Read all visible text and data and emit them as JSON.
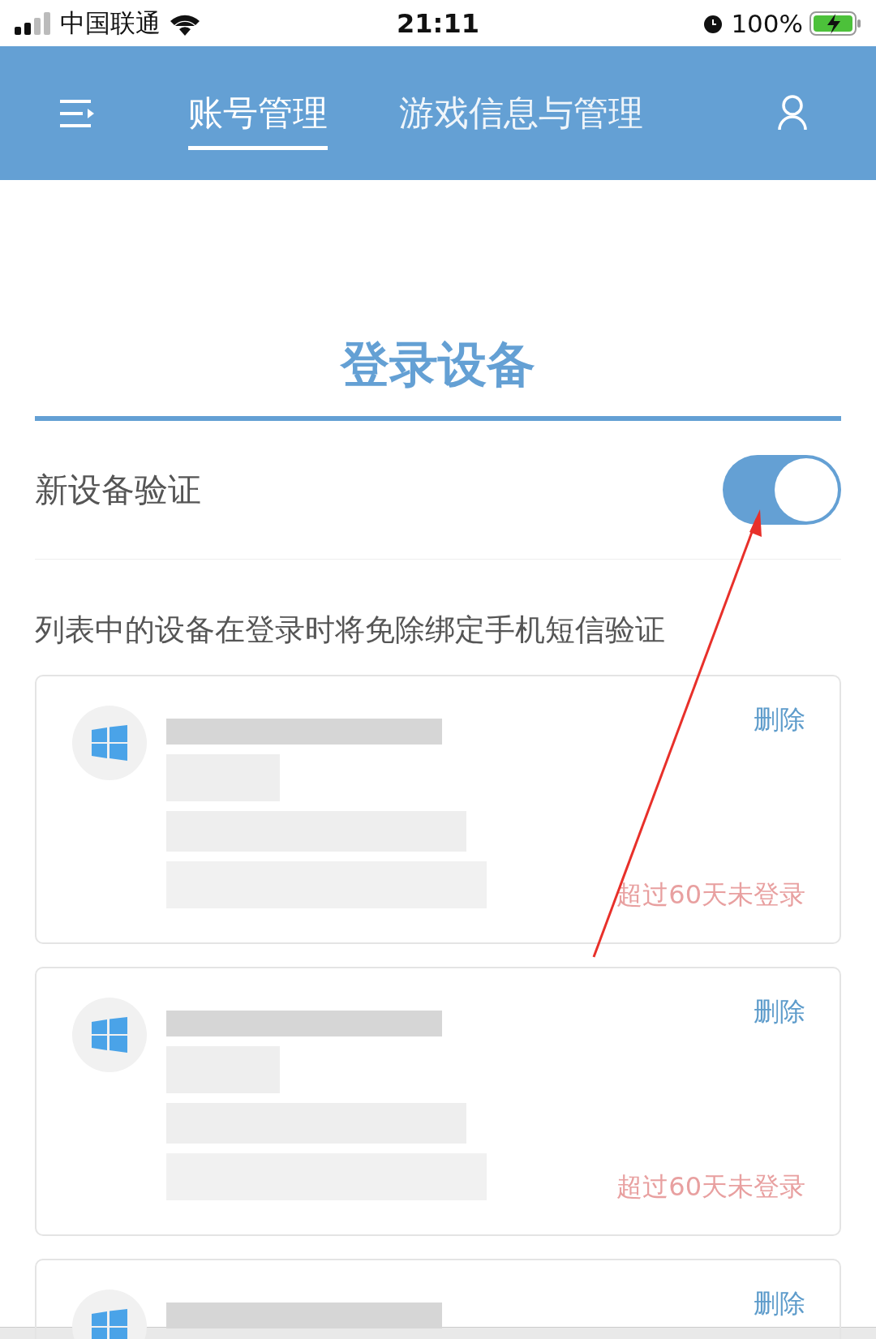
{
  "status_bar": {
    "carrier": "中国联通",
    "time": "21:11",
    "battery": "100%"
  },
  "tabs": [
    {
      "label": "账号管理",
      "selected": true
    },
    {
      "label": "游戏信息与管理",
      "selected": false
    }
  ],
  "title": "登录设备",
  "setting": {
    "label": "新设备验证",
    "on": true
  },
  "note": "列表中的设备在登录时将免除绑定手机短信验证",
  "devices": [
    {
      "delete": "删除",
      "status": "超过60天未登录"
    },
    {
      "delete": "删除",
      "status": "超过60天未登录"
    },
    {
      "delete": "删除"
    }
  ]
}
